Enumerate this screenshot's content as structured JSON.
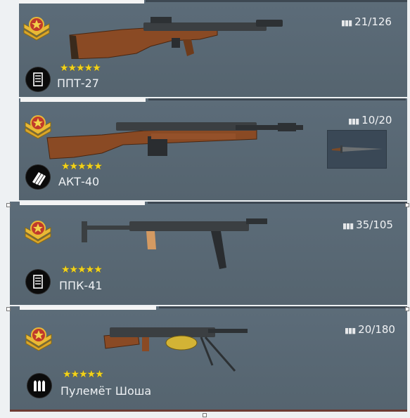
{
  "weapons": [
    {
      "name": "ППТ-27",
      "ammo": "21/126",
      "stars": "★★★★★",
      "rank_icon": "star-chevron-rank",
      "type_icon": "magazine-icon"
    },
    {
      "name": "АКТ-40",
      "ammo": "10/20",
      "stars": "★★★★★",
      "rank_icon": "star-chevron-rank",
      "type_icon": "cartridges-icon",
      "attachment": "bayonet"
    },
    {
      "name": "ППК-41",
      "ammo": "35/105",
      "stars": "★★★★★",
      "rank_icon": "star-chevron-rank",
      "type_icon": "magazine-icon"
    },
    {
      "name": "Пулемёт Шоша",
      "ammo": "20/180",
      "stars": "★★★★★",
      "rank_icon": "star-chevron-rank",
      "type_icon": "bullets-icon"
    }
  ],
  "colors": {
    "card_bg": "#5a6a77",
    "stars": "#f2d21b",
    "rank_gold": "#e8b936",
    "rank_red": "#c0392b",
    "wood": "#8a4a24",
    "metal": "#3b3f42"
  }
}
